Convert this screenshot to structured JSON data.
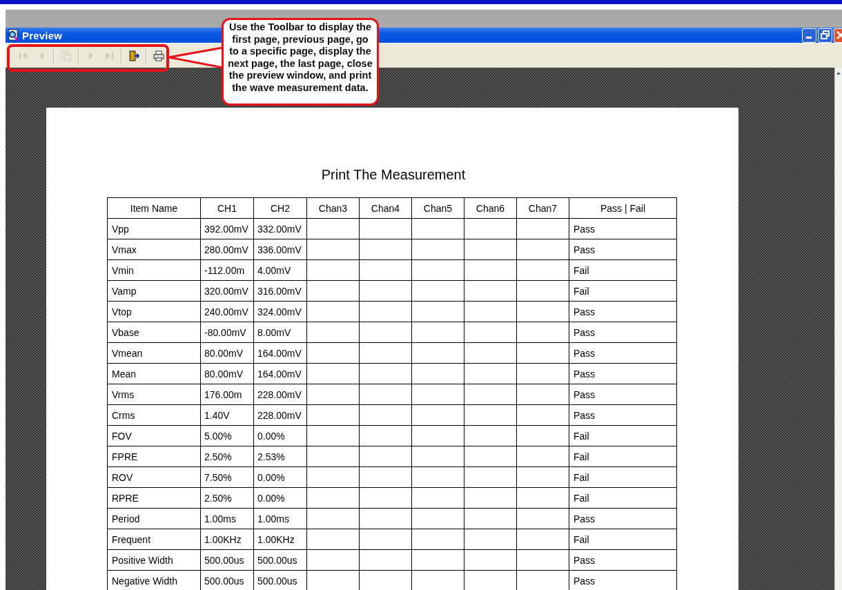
{
  "window": {
    "title": "Preview"
  },
  "toolbar": [
    {
      "kind": "first",
      "disabled": true
    },
    {
      "kind": "prev",
      "disabled": true
    },
    {
      "kind": "sep"
    },
    {
      "kind": "goto",
      "disabled": true
    },
    {
      "kind": "sep"
    },
    {
      "kind": "next",
      "disabled": true
    },
    {
      "kind": "last",
      "disabled": true
    },
    {
      "kind": "sep"
    },
    {
      "kind": "close",
      "disabled": false
    },
    {
      "kind": "sep"
    },
    {
      "kind": "print",
      "disabled": false
    }
  ],
  "callout": "Use the Toolbar to display the first page, previous page, go to a specific page, display the next page, the last page, close the preview window, and print the wave measurement data.",
  "report": {
    "title": "Print The Measurement",
    "columns": [
      "Item Name",
      "CH1",
      "CH2",
      "Chan3",
      "Chan4",
      "Chan5",
      "Chan6",
      "Chan7",
      "Pass | Fail"
    ],
    "rows": [
      {
        "item": "Vpp",
        "ch1": "392.00mV",
        "ch2": "332.00mV",
        "result": "Pass"
      },
      {
        "item": "Vmax",
        "ch1": "280.00mV",
        "ch2": "336.00mV",
        "result": "Pass"
      },
      {
        "item": "Vmin",
        "ch1": "-112.00m",
        "ch2": "4.00mV",
        "result": "Fail"
      },
      {
        "item": "Vamp",
        "ch1": "320.00mV",
        "ch2": "316.00mV",
        "result": "Fail"
      },
      {
        "item": "Vtop",
        "ch1": "240.00mV",
        "ch2": "324.00mV",
        "result": "Pass"
      },
      {
        "item": "Vbase",
        "ch1": "-80.00mV",
        "ch2": "8.00mV",
        "result": "Pass"
      },
      {
        "item": "Vmean",
        "ch1": "80.00mV",
        "ch2": "164.00mV",
        "result": "Pass"
      },
      {
        "item": "Mean",
        "ch1": "80.00mV",
        "ch2": "164.00mV",
        "result": "Pass"
      },
      {
        "item": "Vrms",
        "ch1": "176.00m",
        "ch2": "228.00mV",
        "result": "Pass"
      },
      {
        "item": "Crms",
        "ch1": "1.40V",
        "ch2": "228.00mV",
        "result": "Pass"
      },
      {
        "item": "FOV",
        "ch1": "5.00%",
        "ch2": "0.00%",
        "result": "Fail"
      },
      {
        "item": "FPRE",
        "ch1": "2.50%",
        "ch2": "2.53%",
        "result": "Fail"
      },
      {
        "item": "ROV",
        "ch1": "7.50%",
        "ch2": "0.00%",
        "result": "Fail"
      },
      {
        "item": "RPRE",
        "ch1": "2.50%",
        "ch2": "0.00%",
        "result": "Fail"
      },
      {
        "item": "Period",
        "ch1": "1.00ms",
        "ch2": "1.00ms",
        "result": "Pass"
      },
      {
        "item": "Frequent",
        "ch1": "1.00KHz",
        "ch2": "1.00KHz",
        "result": "Fail"
      },
      {
        "item": "Positive Width",
        "ch1": "500.00us",
        "ch2": "500.00us",
        "result": "Pass"
      },
      {
        "item": "Negative Width",
        "ch1": "500.00us",
        "ch2": "500.00us",
        "result": "Pass"
      }
    ]
  }
}
